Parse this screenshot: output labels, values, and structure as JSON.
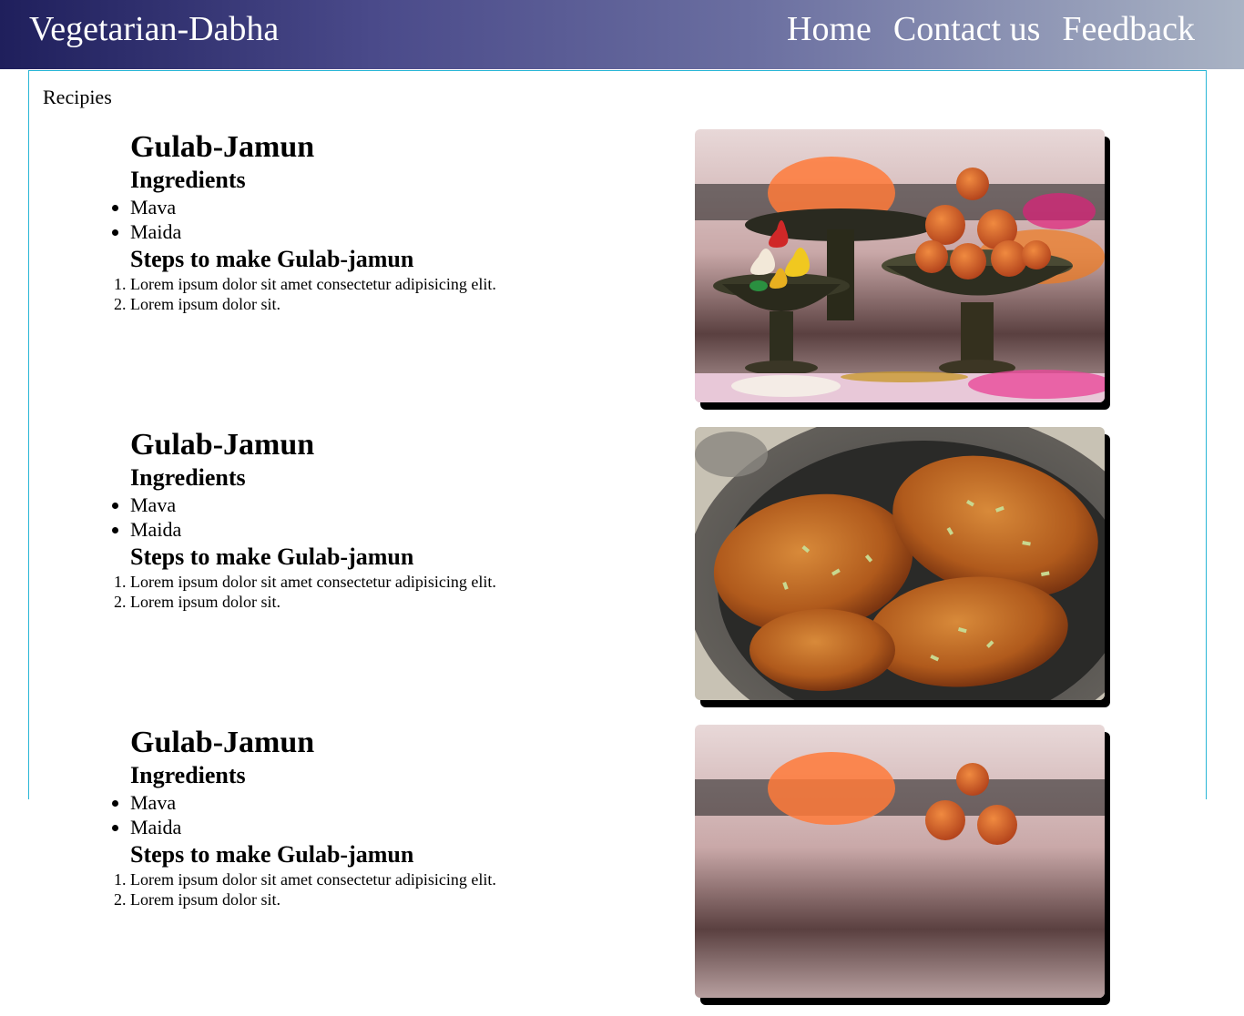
{
  "navbar": {
    "brand": "Vegetarian-Dabha",
    "links": [
      "Home",
      "Contact us",
      "Feedback"
    ]
  },
  "main": {
    "section_title": "Recipies",
    "recipes": [
      {
        "name": "Gulab-Jamun",
        "ingredients_heading": "Ingredients",
        "ingredients": [
          "Mava",
          "Maida"
        ],
        "steps_heading": "Steps to make Gulab-jamun",
        "steps": [
          "Lorem ipsum dolor sit amet consectetur adipisicing elit.",
          "Lorem ipsum dolor sit."
        ],
        "image": "gulab-jamun-bowls-photo"
      },
      {
        "name": "Gulab-Jamun",
        "ingredients_heading": "Ingredients",
        "ingredients": [
          "Mava",
          "Maida"
        ],
        "steps_heading": "Steps to make Gulab-jamun",
        "steps": [
          "Lorem ipsum dolor sit amet consectetur adipisicing elit.",
          "Lorem ipsum dolor sit."
        ],
        "image": "malpua-plate-photo"
      },
      {
        "name": "Gulab-Jamun",
        "ingredients_heading": "Ingredients",
        "ingredients": [
          "Mava",
          "Maida"
        ],
        "steps_heading": "Steps to make Gulab-jamun",
        "steps": [
          "Lorem ipsum dolor sit amet consectetur adipisicing elit.",
          "Lorem ipsum dolor sit."
        ],
        "image": "gulab-jamun-bowls-photo"
      }
    ]
  },
  "colors": {
    "nav_gradient_start": "#1f1f5c",
    "nav_gradient_end": "#a9b3c4",
    "container_border": "#29b6d6"
  }
}
